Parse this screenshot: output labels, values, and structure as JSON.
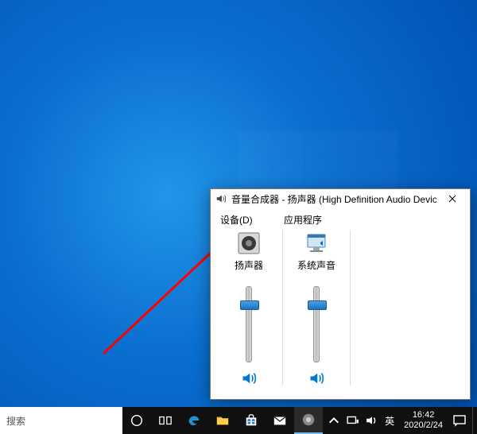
{
  "mixer": {
    "title": "音量合成器 - 扬声器 (High Definition Audio Device)",
    "headers": {
      "device": "设备(D)",
      "apps": "应用程序"
    },
    "device": {
      "label": "扬声器",
      "level": 78
    },
    "apps": [
      {
        "label": "系统声音",
        "level": 78
      }
    ]
  },
  "taskbar": {
    "search_placeholder": "搜索",
    "ime": "英",
    "time": "16:42",
    "date": "2020/2/24"
  }
}
